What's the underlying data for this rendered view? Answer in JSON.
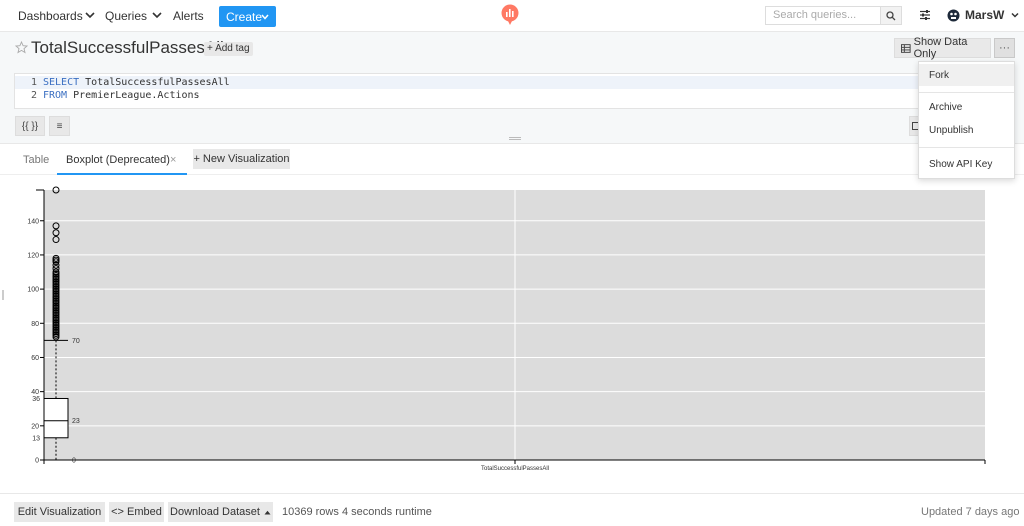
{
  "nav": {
    "dashboards": "Dashboards",
    "queries": "Queries",
    "alerts": "Alerts",
    "create": "Create",
    "search_placeholder": "Search queries...",
    "user": "MarsW"
  },
  "query": {
    "title": "TotalSuccessfulPassesAll",
    "add_tag": "+ Add tag",
    "show_data_only": "Show Data Only",
    "more": "···"
  },
  "editor": {
    "lines": [
      {
        "num": "1",
        "keyword": "SELECT",
        "rest": " TotalSuccessfulPassesAll"
      },
      {
        "num": "2",
        "keyword": "FROM",
        "rest": " PremierLeague.Actions"
      }
    ],
    "params_btn": "{{ }}",
    "format_btn": "≡"
  },
  "menu": {
    "items": [
      "Fork",
      "Archive",
      "Unpublish",
      "Show API Key"
    ]
  },
  "tabs": {
    "table": "Table",
    "boxplot": "Boxplot (Deprecated)",
    "close": "×",
    "new_vis": "+ New Visualization"
  },
  "chart_data": {
    "type": "boxplot",
    "categories": [
      "TotalSuccessfulPassesAll"
    ],
    "box": {
      "min": 0,
      "q1": 13,
      "median": 23,
      "q3": 36,
      "whisker_high": 70
    },
    "outliers": [
      72,
      73,
      74,
      75,
      76,
      77,
      78,
      79,
      80,
      81,
      82,
      83,
      84,
      85,
      86,
      87,
      88,
      89,
      90,
      91,
      92,
      93,
      94,
      95,
      96,
      97,
      98,
      99,
      100,
      101,
      102,
      103,
      104,
      105,
      106,
      107,
      108,
      109,
      110,
      112,
      114,
      116,
      117,
      118,
      129,
      133,
      137,
      158
    ],
    "y_ticks": [
      0,
      20,
      40,
      60,
      80,
      100,
      120,
      140
    ],
    "annotations": [
      "0",
      "13",
      "23",
      "36",
      "70"
    ],
    "ylim": [
      0,
      158
    ],
    "grid": true
  },
  "footer": {
    "edit_vis": "Edit Visualization",
    "embed": "<> Embed",
    "download": "Download Dataset",
    "rows": "10369 rows",
    "runtime": "4 seconds runtime",
    "updated": "Updated 7 days ago"
  },
  "colors": {
    "accent": "#2196f3",
    "plot_bg": "#dcdcdc",
    "logo": "#ff7964"
  }
}
